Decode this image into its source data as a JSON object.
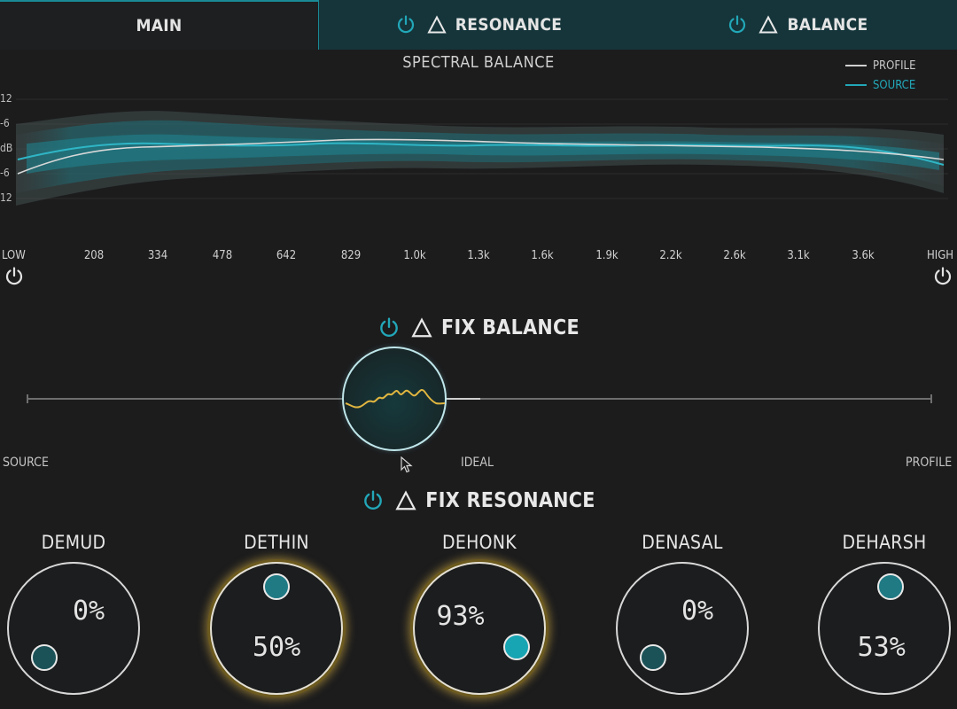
{
  "tabs": [
    {
      "label": "MAIN"
    },
    {
      "label": "RESONANCE"
    },
    {
      "label": "BALANCE"
    }
  ],
  "spectrum": {
    "title": "SPECTRAL BALANCE",
    "legend": [
      {
        "label": "PROFILE",
        "color": "#d0d0d0"
      },
      {
        "label": "SOURCE",
        "color": "#22a7b8"
      }
    ],
    "db_labels": [
      "12",
      "-6",
      "dB",
      "-6",
      "12"
    ],
    "freq_labels": [
      "208",
      "334",
      "478",
      "642",
      "829",
      "1.0k",
      "1.3k",
      "1.6k",
      "1.9k",
      "2.2k",
      "2.6k",
      "3.1k",
      "3.6k"
    ],
    "low_label": "LOW",
    "high_label": "HIGH"
  },
  "fix_balance": {
    "title": "FIX BALANCE",
    "source_label": "SOURCE",
    "ideal_label": "IDEAL",
    "profile_label": "PROFILE"
  },
  "fix_resonance": {
    "title": "FIX RESONANCE",
    "knobs": [
      {
        "name": "DEMUD",
        "value": "0%",
        "level": 0.0,
        "highlighted": false
      },
      {
        "name": "DETHIN",
        "value": "50%",
        "level": 0.5,
        "highlighted": true
      },
      {
        "name": "DEHONK",
        "value": "93%",
        "level": 0.93,
        "highlighted": true
      },
      {
        "name": "DENASAL",
        "value": "0%",
        "level": 0.0,
        "highlighted": false
      },
      {
        "name": "DEHARSH",
        "value": "53%",
        "level": 0.53,
        "highlighted": false
      }
    ]
  },
  "colors": {
    "accent": "#22a7b8",
    "glow": "#d9b242",
    "background": "#1c1c1d"
  }
}
